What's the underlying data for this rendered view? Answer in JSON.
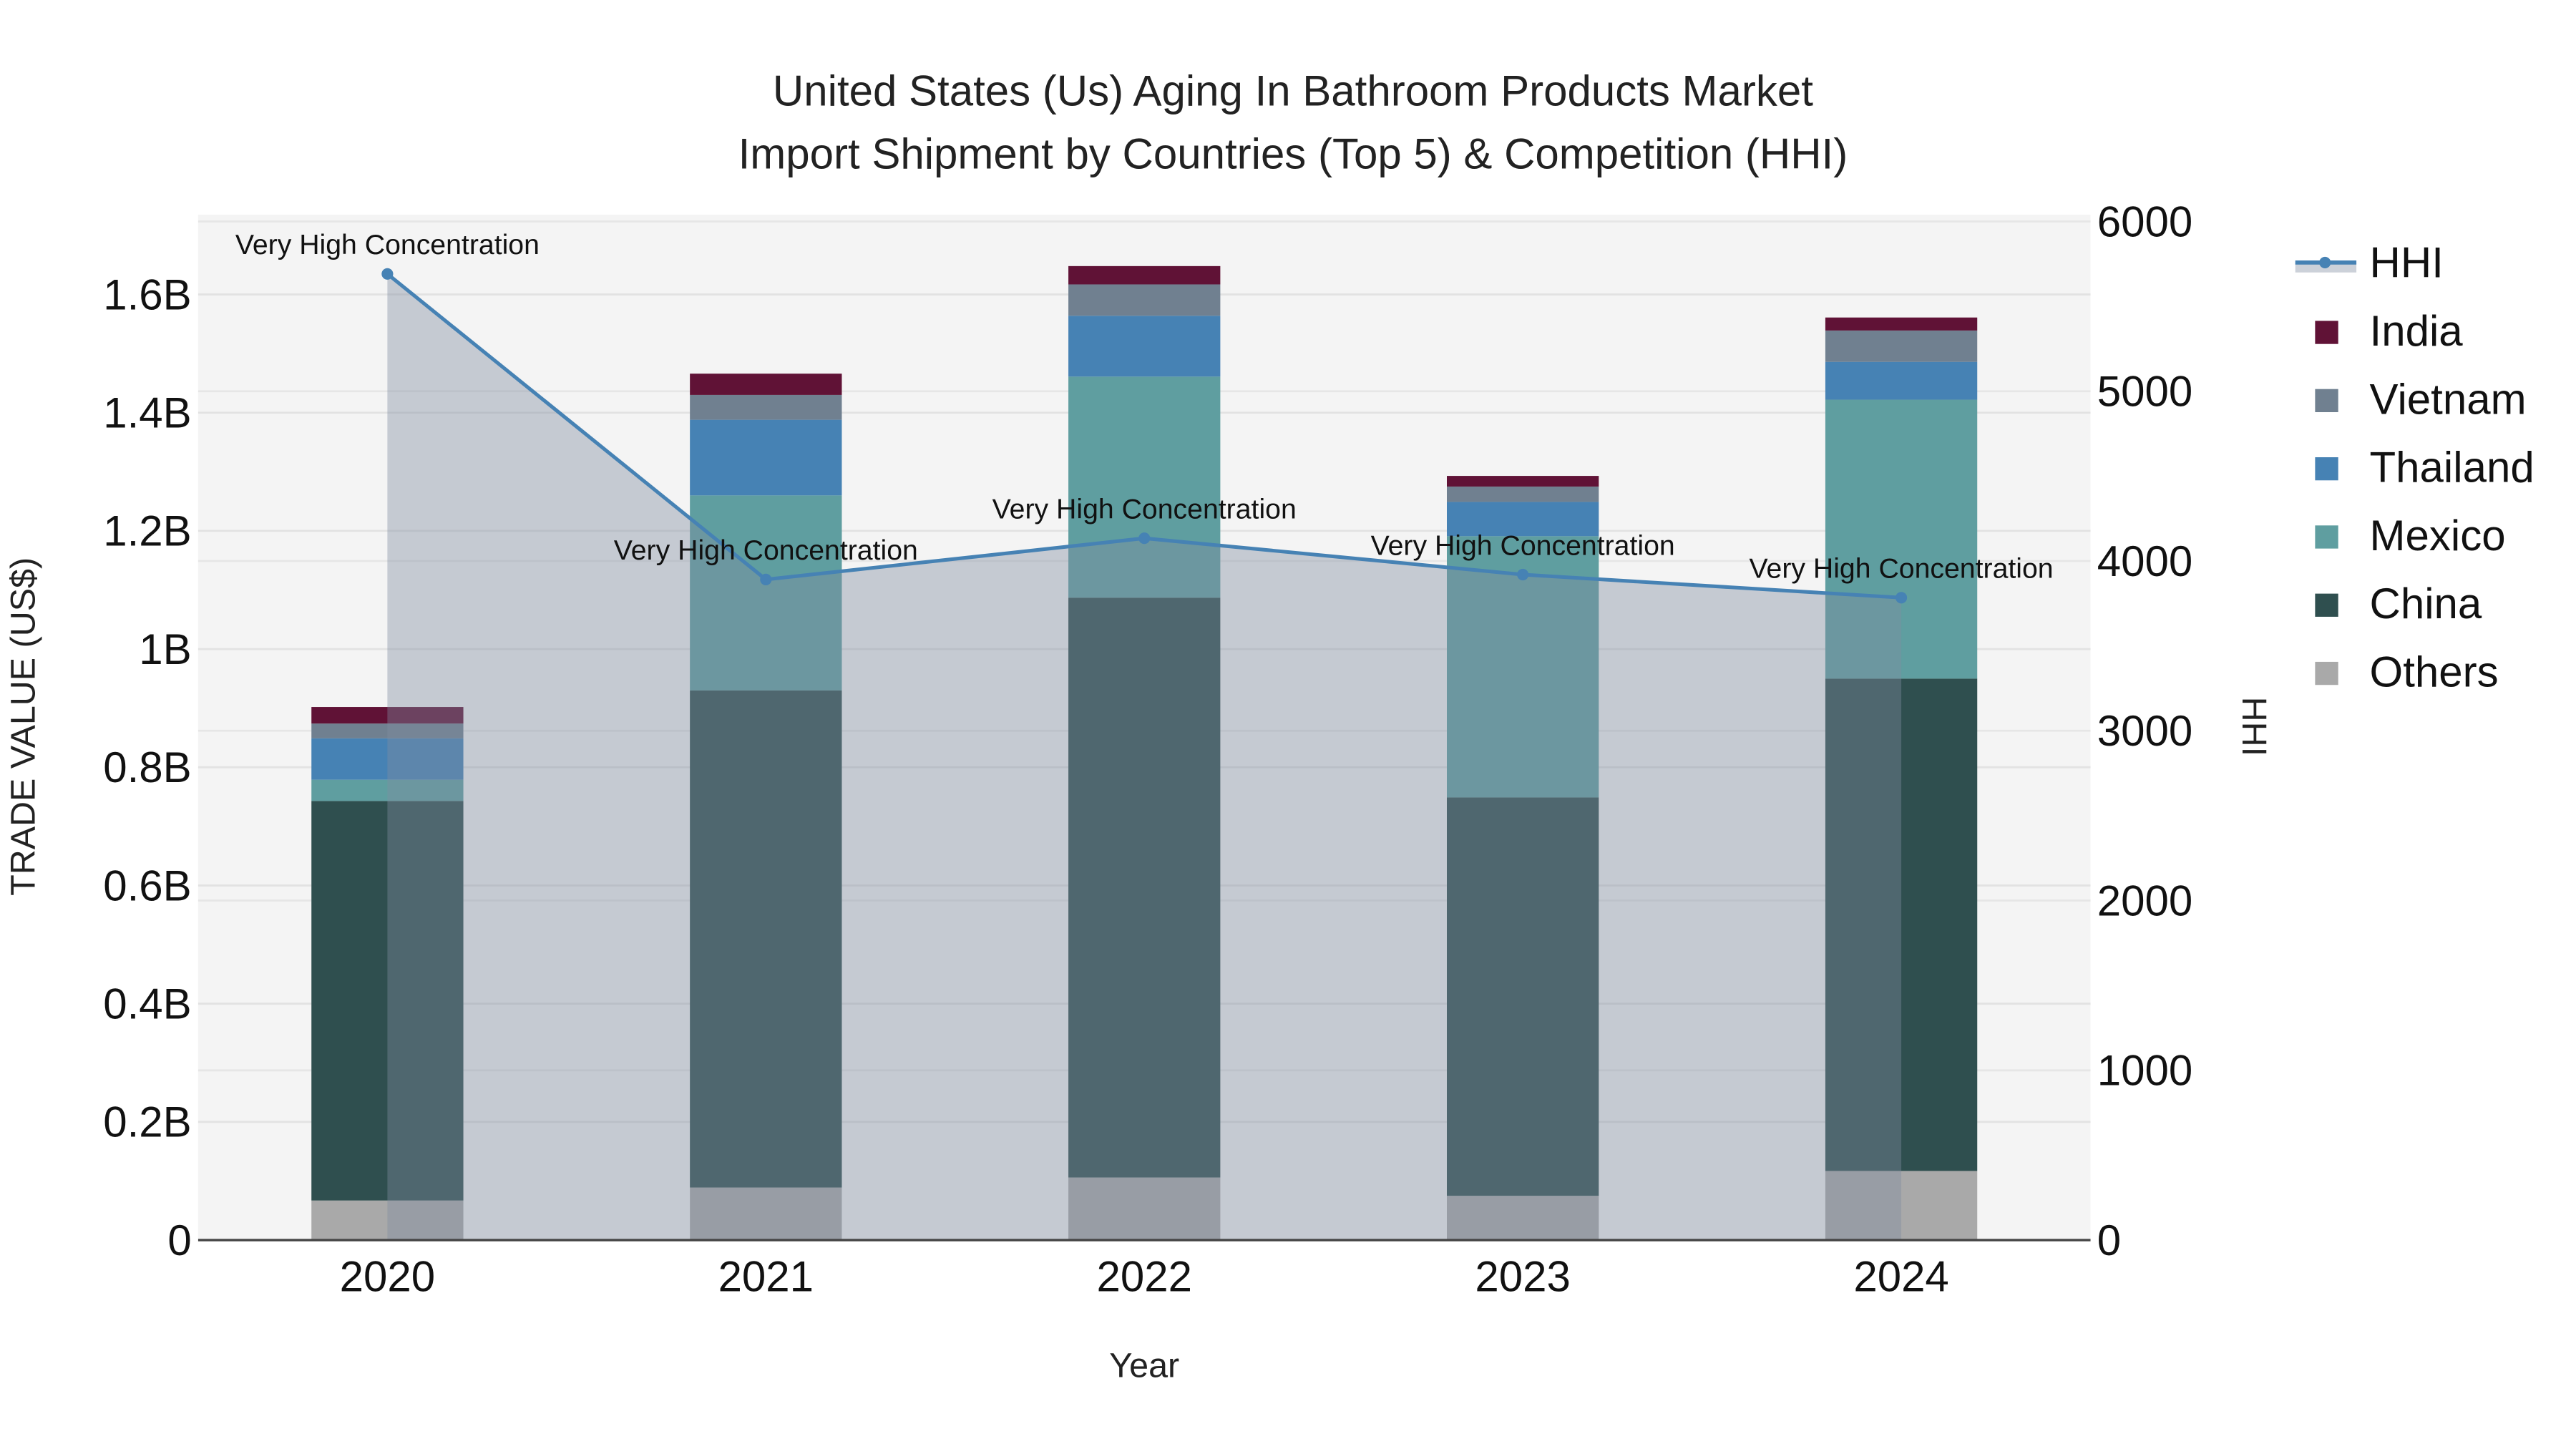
{
  "chart_data": {
    "type": "bar",
    "title": "United States (Us) Aging In Bathroom Products Market",
    "subtitle": "Import Shipment by Countries (Top 5) & Competition (HHI)",
    "xlabel": "Year",
    "ylabel": "TRADE VALUE (US$)",
    "y2label": "HHI",
    "categories": [
      "2020",
      "2021",
      "2022",
      "2023",
      "2024"
    ],
    "ylim": [
      0,
      1.735
    ],
    "y_unit": "B",
    "yticks": [
      0,
      0.2,
      0.4,
      0.6,
      0.8,
      1,
      1.2,
      1.4,
      1.6
    ],
    "ytick_labels": [
      "0",
      "0.2B",
      "0.4B",
      "0.6B",
      "0.8B",
      "1B",
      "1.2B",
      "1.4B",
      "1.6B"
    ],
    "y2lim": [
      0,
      6040
    ],
    "y2ticks": [
      0,
      1000,
      2000,
      3000,
      4000,
      5000,
      6000
    ],
    "y2tick_labels": [
      "0",
      "1000",
      "2000",
      "3000",
      "4000",
      "5000",
      "6000"
    ],
    "grid": true,
    "legend_position": "right",
    "series": [
      {
        "name": "Others",
        "color": "#A9A9A9",
        "values": [
          0.067,
          0.089,
          0.106,
          0.075,
          0.117
        ]
      },
      {
        "name": "China",
        "color": "#2F4F4F",
        "values": [
          0.676,
          0.841,
          0.981,
          0.674,
          0.833
        ]
      },
      {
        "name": "Mexico",
        "color": "#5F9EA0",
        "values": [
          0.036,
          0.33,
          0.374,
          0.442,
          0.472
        ]
      },
      {
        "name": "Thailand",
        "color": "#4682B4",
        "values": [
          0.07,
          0.128,
          0.103,
          0.058,
          0.064
        ]
      },
      {
        "name": "Vietnam",
        "color": "#708090",
        "values": [
          0.025,
          0.042,
          0.053,
          0.026,
          0.053
        ]
      },
      {
        "name": "India",
        "color": "#601236",
        "values": [
          0.028,
          0.036,
          0.031,
          0.018,
          0.022
        ]
      }
    ],
    "hhi": {
      "name": "HHI",
      "color": "#4682B4",
      "values": [
        5691,
        3891,
        4134,
        3920,
        3784
      ],
      "annotations": [
        "Very High Concentration",
        "Very High Concentration",
        "Very High Concentration",
        "Very High Concentration",
        "Very High Concentration"
      ]
    },
    "legend_order": [
      "HHI",
      "India",
      "Vietnam",
      "Thailand",
      "Mexico",
      "China",
      "Others"
    ]
  }
}
